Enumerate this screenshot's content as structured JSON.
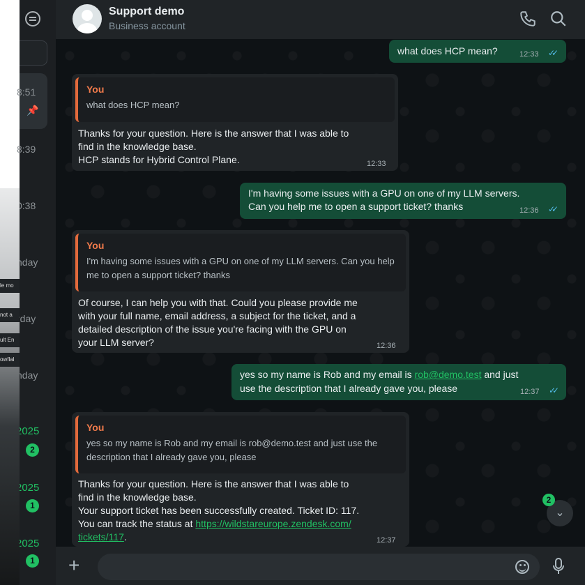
{
  "header": {
    "name": "Support demo",
    "status": "Business account"
  },
  "sidebar": {
    "times": [
      "8:51",
      "8:39",
      "0:38",
      "nday",
      "rday",
      "nday",
      "2025",
      "2025",
      "2025"
    ],
    "badges": [
      "2",
      "1",
      "1"
    ],
    "ghost_rows": [
      "le mo",
      "not a",
      "ult En",
      "owflal"
    ]
  },
  "messages": {
    "m1": {
      "text": "what does HCP mean?",
      "time": "12:33"
    },
    "m2": {
      "quote_author": "You",
      "quote_text": "what does HCP mean?",
      "text": "Thanks for your question. Here is the answer that I was able to\nfind in the knowledge base.\nHCP stands for Hybrid Control Plane.",
      "time": "12:33"
    },
    "m3": {
      "text": "I'm having some issues with a GPU on one of my LLM servers.\nCan you help me to open a support ticket? thanks",
      "time": "12:36"
    },
    "m4": {
      "quote_author": "You",
      "quote_text": "I'm having some issues with a GPU on one of my LLM servers. Can\nyou help me to open a support ticket? thanks",
      "text": "Of course, I can help you with that. Could you please provide me\nwith your full name, email address, a subject for the ticket, and a\ndetailed description of the issue you're facing with the GPU on\nyour LLM server?",
      "time": "12:36"
    },
    "m5": {
      "text_before": "yes so my name is Rob and my email is ",
      "link": "rob@demo.test",
      "text_after": " and just",
      "text_line2": "use the description that I already gave you, please",
      "time": "12:37"
    },
    "m6": {
      "quote_author": "You",
      "quote_text": "yes so my name is Rob and my email is rob@demo.test and just use\nthe description that I already gave you, please",
      "text": "Thanks for your question. Here is the answer that I was able to\nfind in the knowledge base.\nYour support ticket has been successfully created. Ticket ID: 117.",
      "text_before_link": "You can track the status at ",
      "link_line1": "https://wildstareurope.zendesk.com/",
      "link_line2": "tickets/117",
      "text_after_link": ".",
      "time": "12:37"
    }
  },
  "composer": {
    "placeholder": "",
    "unread_count": "2"
  },
  "colors": {
    "outgoing_bubble": "#144d37",
    "incoming_bubble": "#202427",
    "accent": "#21c063",
    "quote_author": "#f07a4b"
  }
}
